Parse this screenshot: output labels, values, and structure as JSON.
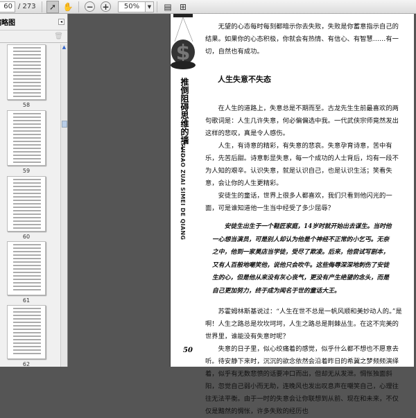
{
  "toolbar": {
    "page_current": "60",
    "page_total": "/ 273",
    "zoom": "50%"
  },
  "sidebar": {
    "title": "缩略图",
    "thumbnails": [
      {
        "label": "58"
      },
      {
        "label": "59"
      },
      {
        "label": "60"
      },
      {
        "label": "61"
      },
      {
        "label": "62"
      }
    ]
  },
  "page": {
    "vertical_title": "推倒阻碍思维的墙……",
    "vertical_pinyin": "TUIDAO ZUAI SIMEI DE QIANG",
    "intro": "无望的心态每时每刻都暗示你去失败，失败是你蓄意指示自己的结果。如果你的心态积极，你就会有热情、有信心、有智慧……有一切，自然也有成功。",
    "heading": "人生失意不失态",
    "paragraphs": [
      "在人生的道路上，失意总是不期而至。古龙先生生前最喜欢的两句歌词是：人生几许失意，何必偏偏选中我。一代武侠宗师竟然发出这样的悲叹，真是令人感伤。",
      "人生，有诗意的精彩，有失意的悲哀。失意孕育诗意，苦中有乐，先苦后甜。诗意彰显失意，每一个成功的人士背后，均有一段不为人知的艰辛。认识失意，就是认识自己，也是认识生活；笑看失意，会让你的人生更精彩。",
      "安徒生的童话，世界上很多人都喜欢，我们只看到他闪光的一面，可是谁知道他一生当中经受了多少屈辱？"
    ],
    "quote": "安徒生出生于一个鞋匠家庭，14岁时就开始出去谋生。当时他一心想当演员，可是别人却认为他是个神经不正常的小乞丐。无奈之中，他到一家昊店当学徒，受尽了欺凌。后来，他尝试写剧本，又有人百般地嘲笑他，说他只会吹牛。这些侮辱深深地刺伤了安徒生的心，但是他从来没有灰心丧气，更没有产生绝望的念头，而是自己更加努力，终于成为闻名于世的童话大王。",
    "paragraphs2": [
      "苏霍姆林斯基说过：“人生在世不总是一帆风顺和美妙动人的。”是啊！人生之路总是坎坎坷坷，人生之路总是荆棘丛生。在这不完美的世界里，谁能没有失意时呢？",
      "失意的日子里，似心绞痛着的感觉，似乎什么都不想也不愿意去听。待安静下来时，沉沉的欲念依然会沿着昨日的希冀之梦频频演绎着，似乎有无数悲愤的话要冲口而出，但却无从发泄。惆怅独面斜阳，忽觉自己弱小而无助，连晚风也发出叹息声在嘲笑自己，心理往往无法平衡。由于一时的失意会让你联想到从前、现在和未来，不仅仅是黯然的惆怅，许多失败的经历也"
    ],
    "page_number": "50"
  }
}
